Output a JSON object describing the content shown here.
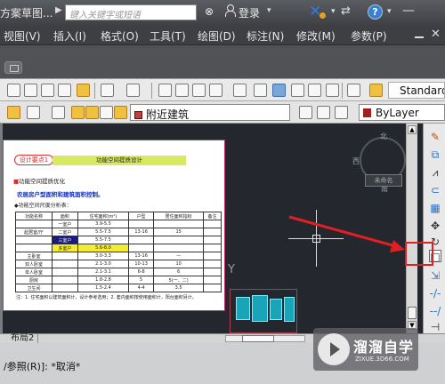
{
  "titlebar": {
    "app_title": "方案草图...",
    "search_placeholder": "键入关键字或短语",
    "login": "登录",
    "help": "?"
  },
  "menubar": {
    "items": [
      "视图(V)",
      "插入(I)",
      "格式(O)",
      "工具(T)",
      "绘图(D)",
      "标注(N)",
      "修改(M)",
      "参数(P)"
    ]
  },
  "toolbar": {
    "text_style": "Standard",
    "layer_name": "附近建筑",
    "color": "ByLayer"
  },
  "viewcube": {
    "north": "北",
    "west": "西",
    "east": "东",
    "south": "南",
    "label": "未命名"
  },
  "document": {
    "tag": "设计要点1",
    "header": "功能空间提质设计",
    "line1": "功能空间提质优化",
    "line2": "农居房户型面积和建筑面积控制。",
    "line3": "◆功能空间尺度分析表：",
    "table": [
      [
        "功能名称",
        "面积",
        "住宅面积(m²)",
        "户型",
        "居住面积指标",
        "备注"
      ],
      [
        "",
        "一室户",
        "3.9-5.5",
        "",
        "",
        ""
      ],
      [
        "起居室/厅",
        "二室户",
        "5.5-7.5",
        "13-16",
        "15",
        ""
      ],
      [
        "",
        "三室户",
        "5.5-7.5",
        "",
        "",
        ""
      ],
      [
        "",
        "多室户",
        "5.6-8.0",
        "",
        "",
        ""
      ],
      [
        "主卧室",
        "",
        "3.0-3.3",
        "13-16",
        "—",
        ""
      ],
      [
        "双人卧室",
        "",
        "2.1-3.0",
        "10-13",
        "10",
        ""
      ],
      [
        "单人卧室",
        "",
        "2.1-3.1",
        "6-8",
        "6",
        ""
      ],
      [
        "厨房",
        "",
        "1.8-2.8",
        "5",
        "5(一、二)",
        ""
      ],
      [
        "卫生间",
        "",
        "1.5-2.4",
        "4-4",
        "3.5",
        ""
      ]
    ],
    "footnote": "注：1. 住宅面积以建筑面积计，设计参考选用；2. 套内面积按使用面积计，阳台面积另计。"
  },
  "tabs": {
    "layout2": "布局2"
  },
  "command": {
    "text": "/参照(R)]: *取消*"
  },
  "watermark": {
    "name": "溜溜自学",
    "url": "ZIXUE.3D66.COM"
  },
  "colors": {
    "canvas": "#24282e",
    "highlight": "#e02020",
    "menubar": "#3d3f43"
  }
}
